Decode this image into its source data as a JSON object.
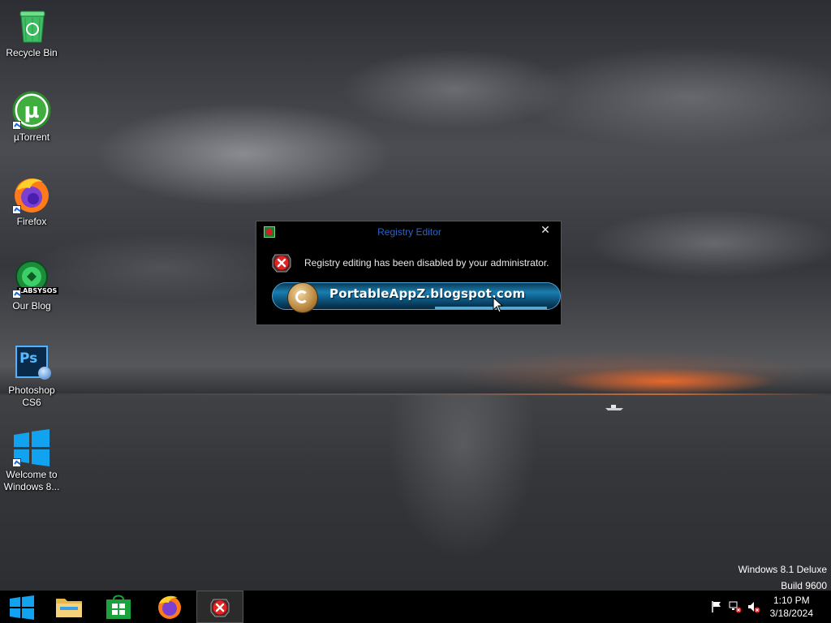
{
  "desktop": {
    "icons": [
      {
        "label": "Recycle Bin",
        "icon": "recycle-bin-icon"
      },
      {
        "label": "µTorrent",
        "icon": "utorrent-icon"
      },
      {
        "label": "Firefox",
        "icon": "firefox-icon"
      },
      {
        "label": "Our Blog",
        "icon": "our-blog-icon",
        "badge_text": "LABSYSOS"
      },
      {
        "label": "Photoshop CS6",
        "icon": "photoshop-icon",
        "badge_text": "Ps"
      },
      {
        "label": "Welcome to Windows 8...",
        "icon": "windows-logo-icon"
      }
    ]
  },
  "dialog": {
    "title": "Registry Editor",
    "close_label": "✕",
    "message": "Registry editing has been disabled by your administrator.",
    "banner_text": "PortableAppZ.blogspot.com"
  },
  "watermark": {
    "line1": "Windows 8.1 Deluxe",
    "line2": "Build 9600"
  },
  "taskbar": {
    "buttons": [
      {
        "name": "start",
        "icon": "windows-start-icon"
      },
      {
        "name": "file-explorer",
        "icon": "file-explorer-icon"
      },
      {
        "name": "store",
        "icon": "store-icon"
      },
      {
        "name": "firefox",
        "icon": "firefox-icon"
      },
      {
        "name": "registry-editor",
        "icon": "error-app-icon",
        "active": true
      }
    ],
    "tray": [
      "flag-icon",
      "network-icon",
      "volume-muted-icon"
    ],
    "clock_time": "1:10 PM",
    "clock_date": "3/18/2024"
  },
  "colors": {
    "dialog_title": "#2b63c9",
    "accent_blue": "#1a8fe8"
  }
}
